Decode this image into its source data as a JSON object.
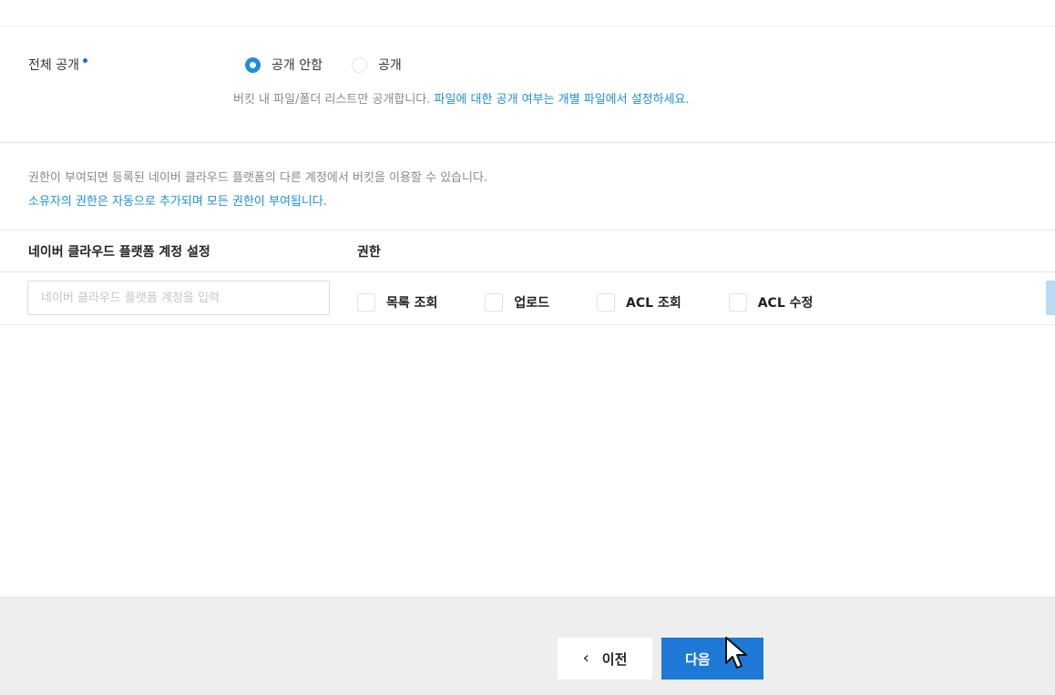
{
  "public_setting": {
    "label": "전체 공개",
    "options": [
      {
        "label": "공개 안함",
        "checked": true
      },
      {
        "label": "공개",
        "checked": false
      }
    ],
    "help_text": "버킷 내 파일/폴더 리스트만 공개합니다.",
    "help_link": "파일에 대한 공개 여부는 개별 파일에서 설정하세요."
  },
  "permission_info": {
    "line1": "권한이 부여되면 등록된 네이버 클라우드 플랫폼의 다른 계정에서 버킷을 이용할 수 있습니다.",
    "line2": "소유자의 권한은 자동으로 추가되며 모든 권한이 부여됩니다."
  },
  "table": {
    "col_account": "네이버 클라우드 플랫폼 계정 설정",
    "col_permission": "권한",
    "account_placeholder": "네이버 클라우드 플랫폼 계정을 입력",
    "permissions": [
      {
        "label": "목록 조회",
        "checked": false
      },
      {
        "label": "업로드",
        "checked": false
      },
      {
        "label": "ACL 조회",
        "checked": false
      },
      {
        "label": "ACL 수정",
        "checked": false
      }
    ]
  },
  "footer": {
    "prev_label": "이전",
    "next_label": "다음"
  },
  "colors": {
    "accent": "#1e8fd9",
    "primary_button": "#1e78d6"
  },
  "icons": {
    "prev": "chevron-left-icon",
    "required": "required-dot-icon",
    "pointer": "mouse-cursor-icon"
  }
}
